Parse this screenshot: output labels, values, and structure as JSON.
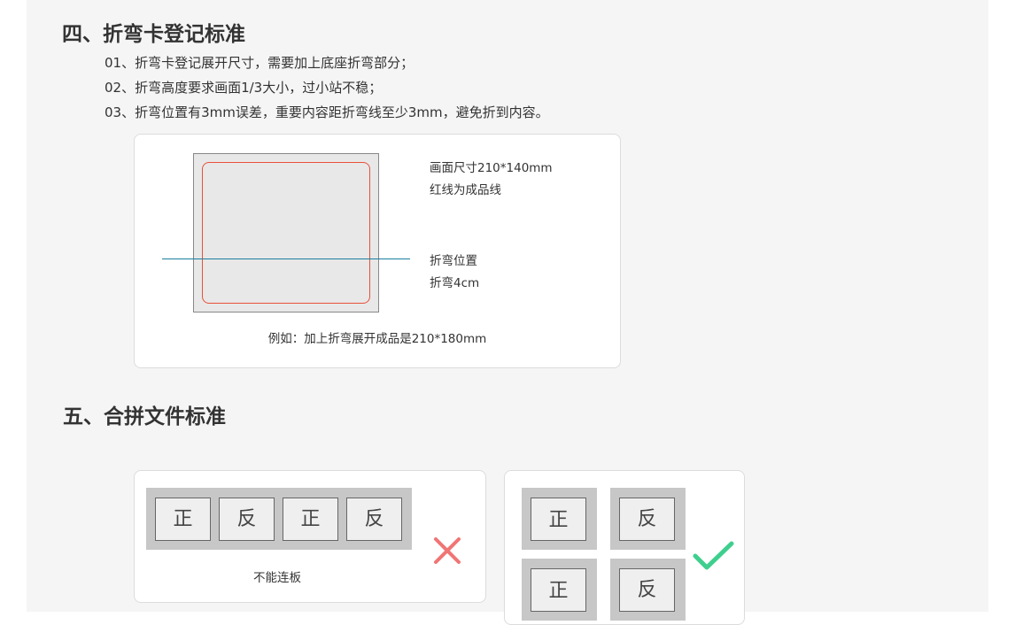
{
  "section4": {
    "title": "四、折弯卡登记标准",
    "rules": [
      "01、折弯卡登记展开尺寸，需要加上底座折弯部分；",
      "02、折弯高度要求画面1/3大小，过小站不稳；",
      "03、折弯位置有3mm误差，重要内容距折弯线至少3mm，避免折到内容。"
    ],
    "diagram": {
      "size_label": "画面尺寸210*140mm",
      "redline_label": "红线为成品线",
      "fold_label": "折弯位置",
      "fold_size_label": "折弯4cm",
      "example": "例如：加上折弯展开成品是210*180mm"
    }
  },
  "section5": {
    "title": "五、合拼文件标准",
    "wrong": {
      "cells": [
        "正",
        "反",
        "正",
        "反"
      ],
      "caption": "不能连板",
      "mark_icon": "cross-icon"
    },
    "right": {
      "cells": [
        "正",
        "反",
        "正",
        "反"
      ],
      "mark_icon": "check-icon"
    }
  },
  "colors": {
    "finish_line": "#e8503a",
    "fold_line": "#1a7fa0",
    "cross": "#f07575",
    "check": "#3ecf8e"
  }
}
